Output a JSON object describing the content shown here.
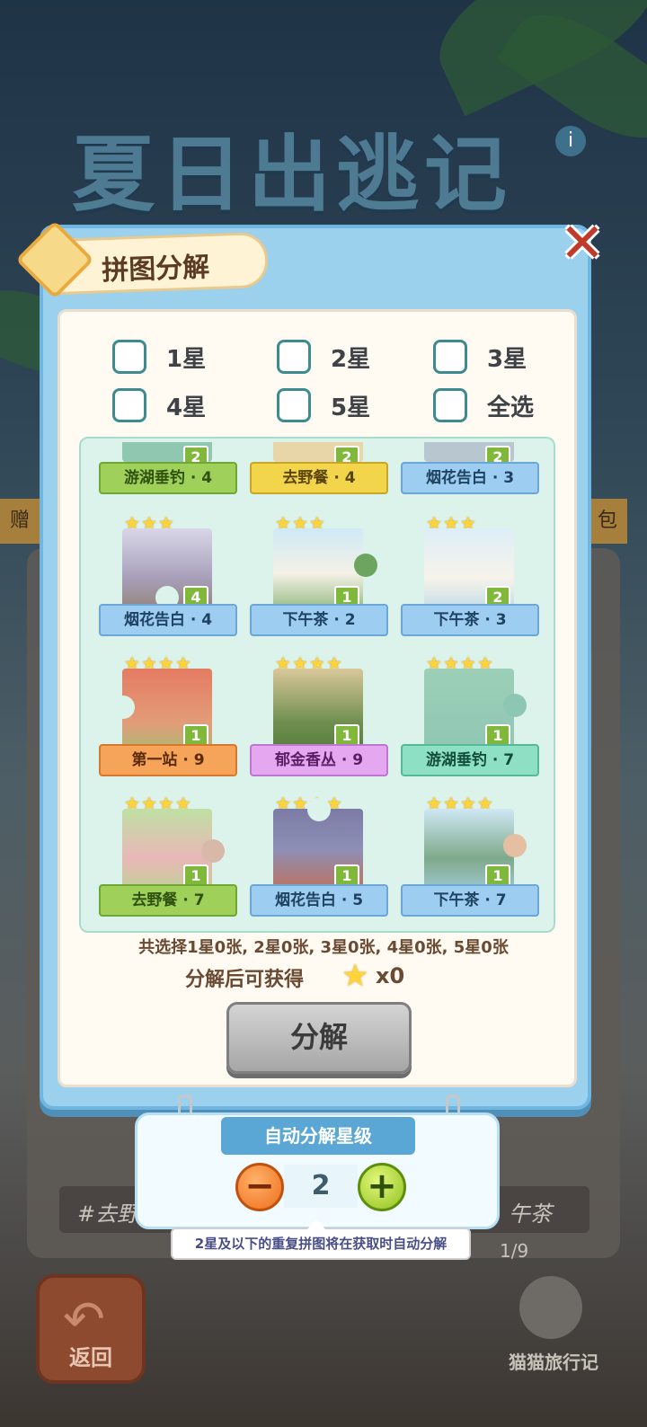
{
  "background": {
    "title": "夏日出逃记",
    "side_left": "赠",
    "side_right": "包",
    "strip_left": "#去野",
    "strip_right": "午茶",
    "progress": "1/9",
    "back_label": "返回",
    "brand": "猫猫旅行记"
  },
  "dialog": {
    "title": "拼图分解",
    "close_icon": "close-icon"
  },
  "filters": [
    {
      "label": "1星"
    },
    {
      "label": "2星"
    },
    {
      "label": "3星"
    },
    {
      "label": "4星"
    },
    {
      "label": "5星"
    },
    {
      "label": "全选"
    }
  ],
  "pieces": [
    {
      "name": "游湖垂钓 · 4",
      "stars": 0,
      "count": "2",
      "color": "green"
    },
    {
      "name": "去野餐 · 4",
      "stars": 0,
      "count": "2",
      "color": "yellow"
    },
    {
      "name": "烟花告白 · 3",
      "stars": 0,
      "count": "2",
      "color": "blue"
    },
    {
      "name": "烟花告白 · 4",
      "stars": 3,
      "count": "4",
      "color": "blue"
    },
    {
      "name": "下午茶 · 2",
      "stars": 3,
      "count": "1",
      "color": "blue"
    },
    {
      "name": "下午茶 · 3",
      "stars": 3,
      "count": "2",
      "color": "blue"
    },
    {
      "name": "第一站 · 9",
      "stars": 4,
      "count": "1",
      "color": "orange"
    },
    {
      "name": "郁金香丛 · 9",
      "stars": 4,
      "count": "1",
      "color": "purple"
    },
    {
      "name": "游湖垂钓 · 7",
      "stars": 4,
      "count": "1",
      "color": "teal"
    },
    {
      "name": "去野餐 · 7",
      "stars": 4,
      "count": "1",
      "color": "green"
    },
    {
      "name": "烟花告白 · 5",
      "stars": 4,
      "count": "1",
      "color": "blue"
    },
    {
      "name": "下午茶 · 7",
      "stars": 4,
      "count": "1",
      "color": "blue"
    }
  ],
  "summary": "共选择1星0张, 2星0张, 3星0张, 4星0张, 5星0张",
  "gain": {
    "label": "分解后可获得",
    "value": "x0",
    "icon": "star-icon"
  },
  "decompose_button": "分解",
  "auto": {
    "title": "自动分解星级",
    "level": "2",
    "minus_icon": "minus-icon",
    "plus_icon": "plus-icon",
    "tip": "2星及以下的重复拼图将在获取时自动分解"
  }
}
